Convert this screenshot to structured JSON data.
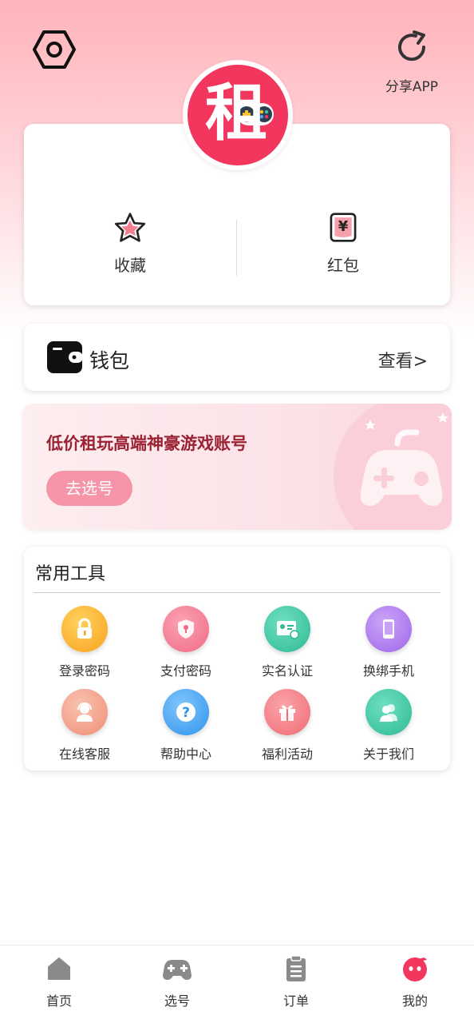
{
  "header": {
    "settings_icon": "settings-hex-icon",
    "share_label": "分享APP",
    "share_icon": "share-refresh-icon",
    "logo_char": "租"
  },
  "profile_card": {
    "favorites_label": "收藏",
    "red_packet_label": "红包",
    "red_packet_symbol": "¥"
  },
  "wallet": {
    "label": "钱包",
    "view_label": "查看>"
  },
  "banner": {
    "title": "低价租玩高端神豪游戏账号",
    "button_label": "去选号"
  },
  "tools": {
    "title": "常用工具",
    "items": [
      {
        "label": "登录密码",
        "icon": "lock-icon",
        "color": "#f9b12e"
      },
      {
        "label": "支付密码",
        "icon": "shield-icon",
        "color": "#f47f93"
      },
      {
        "label": "实名认证",
        "icon": "id-card-icon",
        "color": "#3cc4a4"
      },
      {
        "label": "换绑手机",
        "icon": "phone-icon",
        "color": "#b07cf0"
      },
      {
        "label": "在线客服",
        "icon": "headset-icon",
        "color": "#f3a088"
      },
      {
        "label": "帮助中心",
        "icon": "help-icon",
        "color": "#4aa8f5"
      },
      {
        "label": "福利活动",
        "icon": "gift-icon",
        "color": "#f47f87"
      },
      {
        "label": "关于我们",
        "icon": "users-icon",
        "color": "#3cc4a4"
      }
    ]
  },
  "tabbar": {
    "items": [
      {
        "label": "首页",
        "icon": "home-icon"
      },
      {
        "label": "选号",
        "icon": "gamepad-icon"
      },
      {
        "label": "订单",
        "icon": "clipboard-icon"
      },
      {
        "label": "我的",
        "icon": "profile-face-icon",
        "active_color": "#f2365e"
      }
    ]
  }
}
